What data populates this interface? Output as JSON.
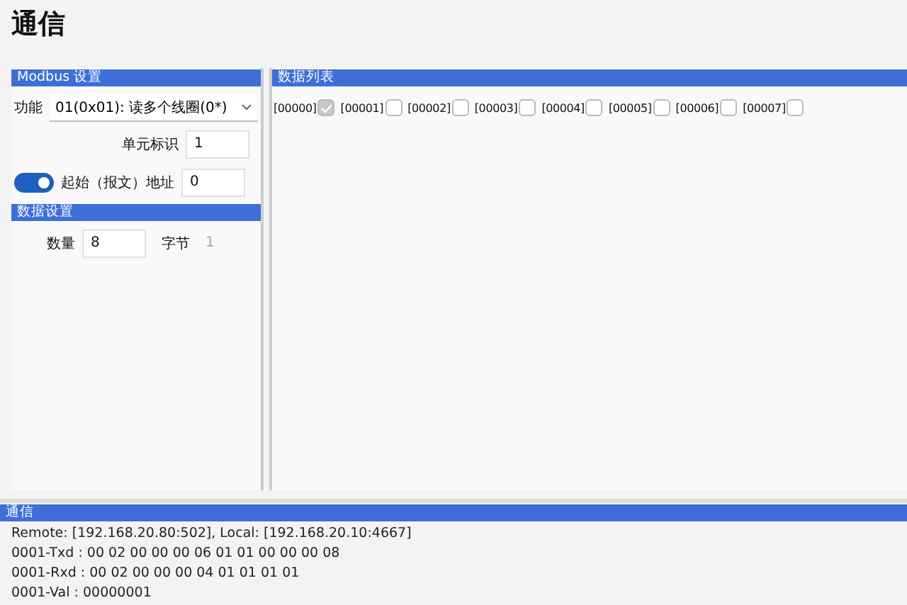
{
  "title": "通信",
  "modbus": {
    "header": "Modbus 设置",
    "function_label": "功能",
    "function_value": "01(0x01): 读多个线圈(0*)",
    "unit_label": "单元标识",
    "unit_value": "1",
    "address_toggle": {
      "on": true
    },
    "address_label": "起始（报文）地址",
    "address_value": "0"
  },
  "data_settings": {
    "header": "数据设置",
    "count_label": "数量",
    "count_value": "8",
    "bytes_label": "字节",
    "bytes_value": "1"
  },
  "data_list": {
    "header": "数据列表",
    "items": [
      {
        "label": "[00000]",
        "checked": true
      },
      {
        "label": "[00001]",
        "checked": false
      },
      {
        "label": "[00002]",
        "checked": false
      },
      {
        "label": "[00003]",
        "checked": false
      },
      {
        "label": "[00004]",
        "checked": false
      },
      {
        "label": "[00005]",
        "checked": false
      },
      {
        "label": "[00006]",
        "checked": false
      },
      {
        "label": "[00007]",
        "checked": false
      }
    ]
  },
  "log": {
    "header": "通信",
    "lines": [
      "Remote: [192.168.20.80:502], Local: [192.168.20.10:4667]",
      "0001-Txd : 00 02 00 00 00 06 01 01 00 00 00 08",
      "0001-Rxd : 00 02 00 00 00 04 01 01 01 01",
      "0001-Val : 00000001"
    ]
  }
}
